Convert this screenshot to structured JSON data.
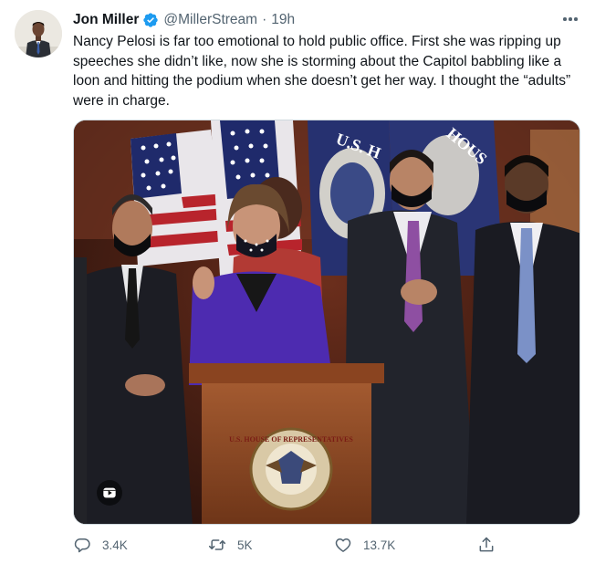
{
  "author": {
    "name": "Jon Miller",
    "handle": "@MillerStream",
    "time": "19h",
    "verified": true
  },
  "tweet_text": "Nancy Pelosi is far too emotional to hold public office. First she was ripping up speeches she didn’t like, now she is storming about the Capitol babbling like a loon and hitting the podium when she doesn’t get her way. I thought the “adults” were in charge.",
  "media": {
    "type": "video",
    "seal_text": "U.S. HOUSE OF REPRESENTATIVES",
    "flag_text_left": "U.S. H",
    "flag_text_right": "HOUS"
  },
  "actions": {
    "replies": "3.4K",
    "retweets": "5K",
    "likes": "13.7K"
  },
  "icons": [
    "verified-icon",
    "more-icon",
    "reply-icon",
    "retweet-icon",
    "like-icon",
    "share-icon",
    "video-badge-icon"
  ],
  "colors": {
    "verified": "#1d9bf0",
    "secondary_text": "#536471",
    "primary_text": "#0f1419"
  }
}
